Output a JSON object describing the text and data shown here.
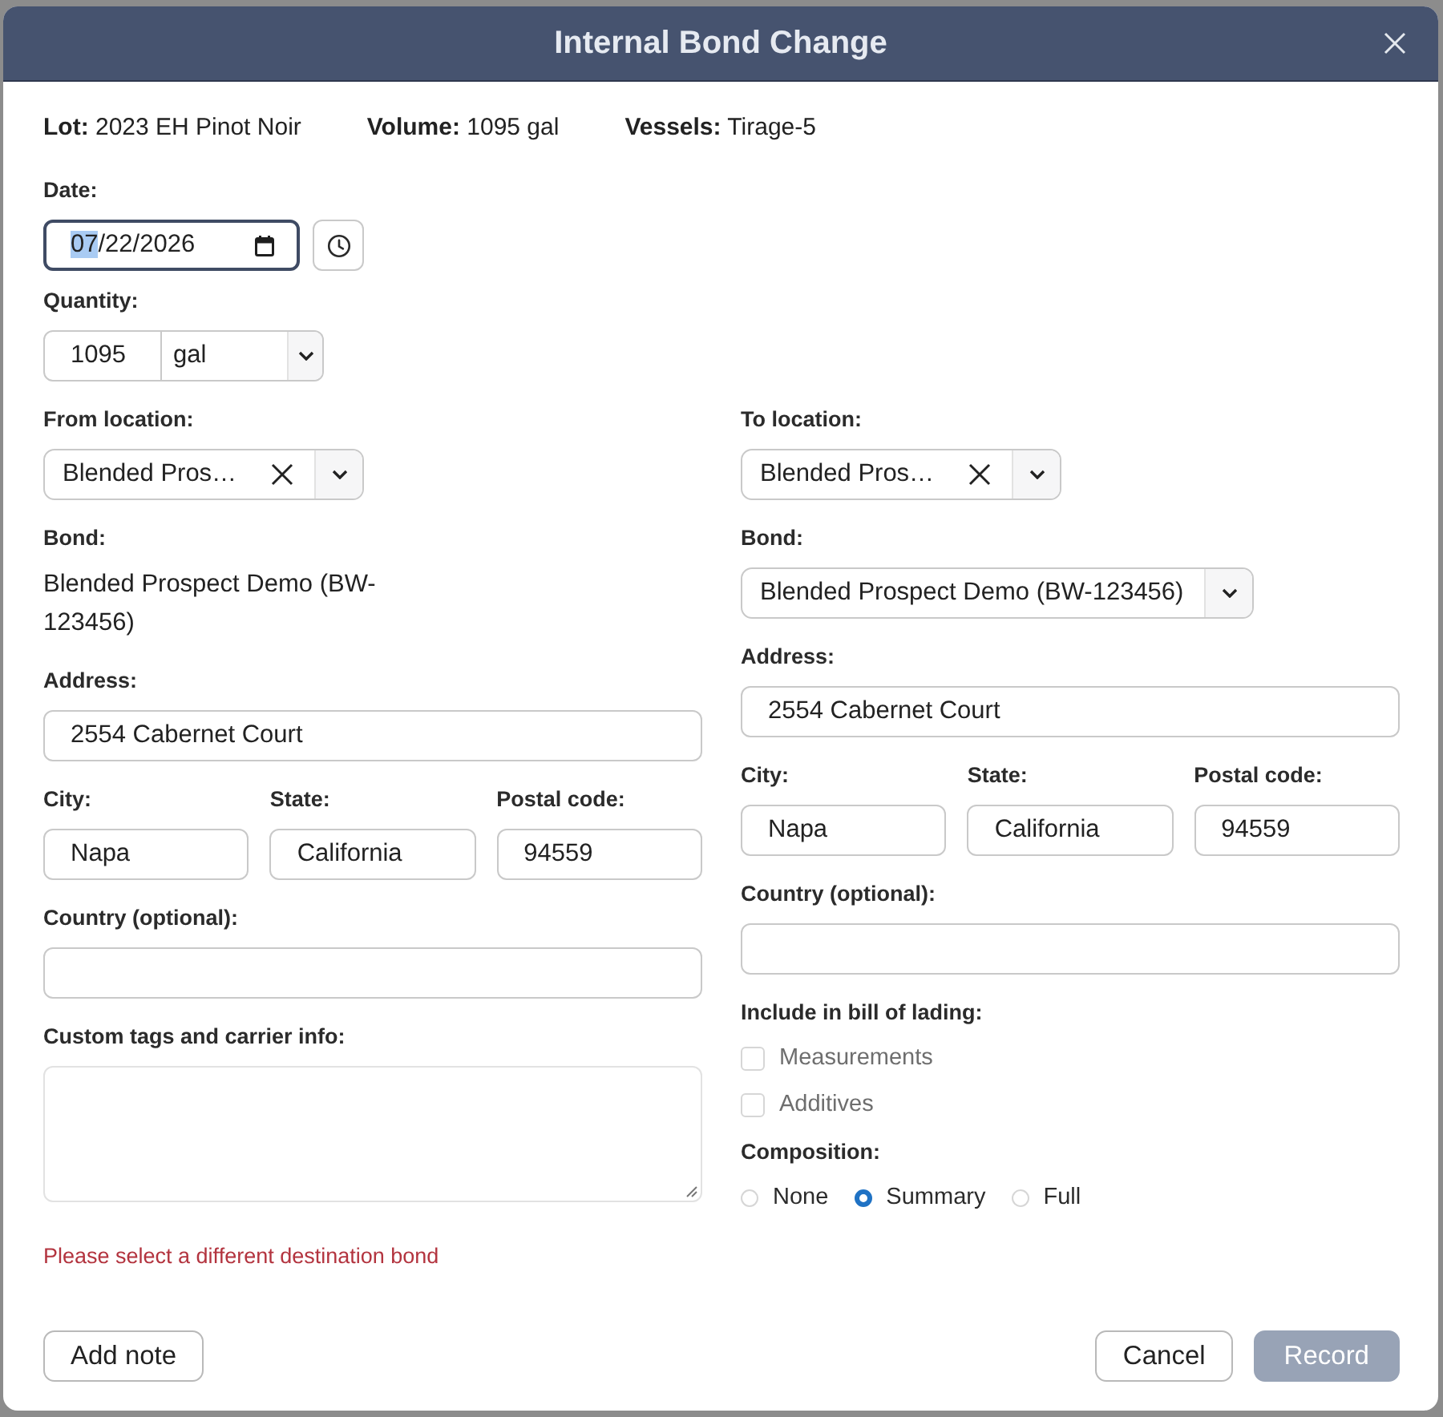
{
  "dialog": {
    "title": "Internal Bond Change"
  },
  "summary": [
    {
      "label": "Lot:",
      "value": "2023 EH Pinot Noir"
    },
    {
      "label": "Volume:",
      "value": "1095 gal"
    },
    {
      "label": "Vessels:",
      "value": "Tirage-5"
    }
  ],
  "date": {
    "label": "Date:",
    "focused": true,
    "segments": [
      {
        "text": "07",
        "selected": true
      },
      {
        "text": "/22/2026",
        "selected": false
      }
    ]
  },
  "quantity": {
    "label": "Quantity:",
    "value": "1095",
    "unit": "gal"
  },
  "locations": [
    {
      "location": {
        "label": "From location:",
        "value": "Blended Pros…"
      },
      "bond": {
        "label": "Bond:",
        "kind": "text",
        "value": "Blended Prospect Demo (BW-123456)"
      },
      "address": {
        "label": "Address:",
        "value": "2554 Cabernet Court"
      },
      "place": [
        {
          "label": "City:",
          "value": "Napa"
        },
        {
          "label": "State:",
          "value": "California"
        },
        {
          "label": "Postal code:",
          "value": "94559"
        }
      ],
      "country": {
        "label": "Country (optional):"
      },
      "tags": {
        "label": "Custom tags and carrier info:"
      },
      "error": "Please select a different destination bond"
    },
    {
      "location": {
        "label": "To location:",
        "value": "Blended Pros…"
      },
      "bond": {
        "label": "Bond:",
        "kind": "select",
        "value": "Blended Prospect Demo (BW-123456)"
      },
      "address": {
        "label": "Address:",
        "value": "2554 Cabernet Court"
      },
      "place": [
        {
          "label": "City:",
          "value": "Napa"
        },
        {
          "label": "State:",
          "value": "California"
        },
        {
          "label": "Postal code:",
          "value": "94559"
        }
      ],
      "country": {
        "label": "Country (optional):"
      },
      "bill_of_lading": {
        "label": "Include in bill of lading:",
        "options": [
          {
            "label": "Measurements",
            "checked": false,
            "disabled": true
          },
          {
            "label": "Additives",
            "checked": false,
            "disabled": true
          }
        ]
      },
      "composition": {
        "label": "Composition:",
        "options": [
          {
            "label": "None",
            "selected": false
          },
          {
            "label": "Summary",
            "selected": true
          },
          {
            "label": "Full",
            "selected": false
          }
        ]
      }
    }
  ],
  "footer": {
    "left": [
      {
        "label": "Add note",
        "kind": "secondary",
        "disabled": false
      }
    ],
    "right": [
      {
        "label": "Cancel",
        "kind": "secondary",
        "disabled": false
      },
      {
        "label": "Record",
        "kind": "primary",
        "disabled": true
      }
    ]
  }
}
